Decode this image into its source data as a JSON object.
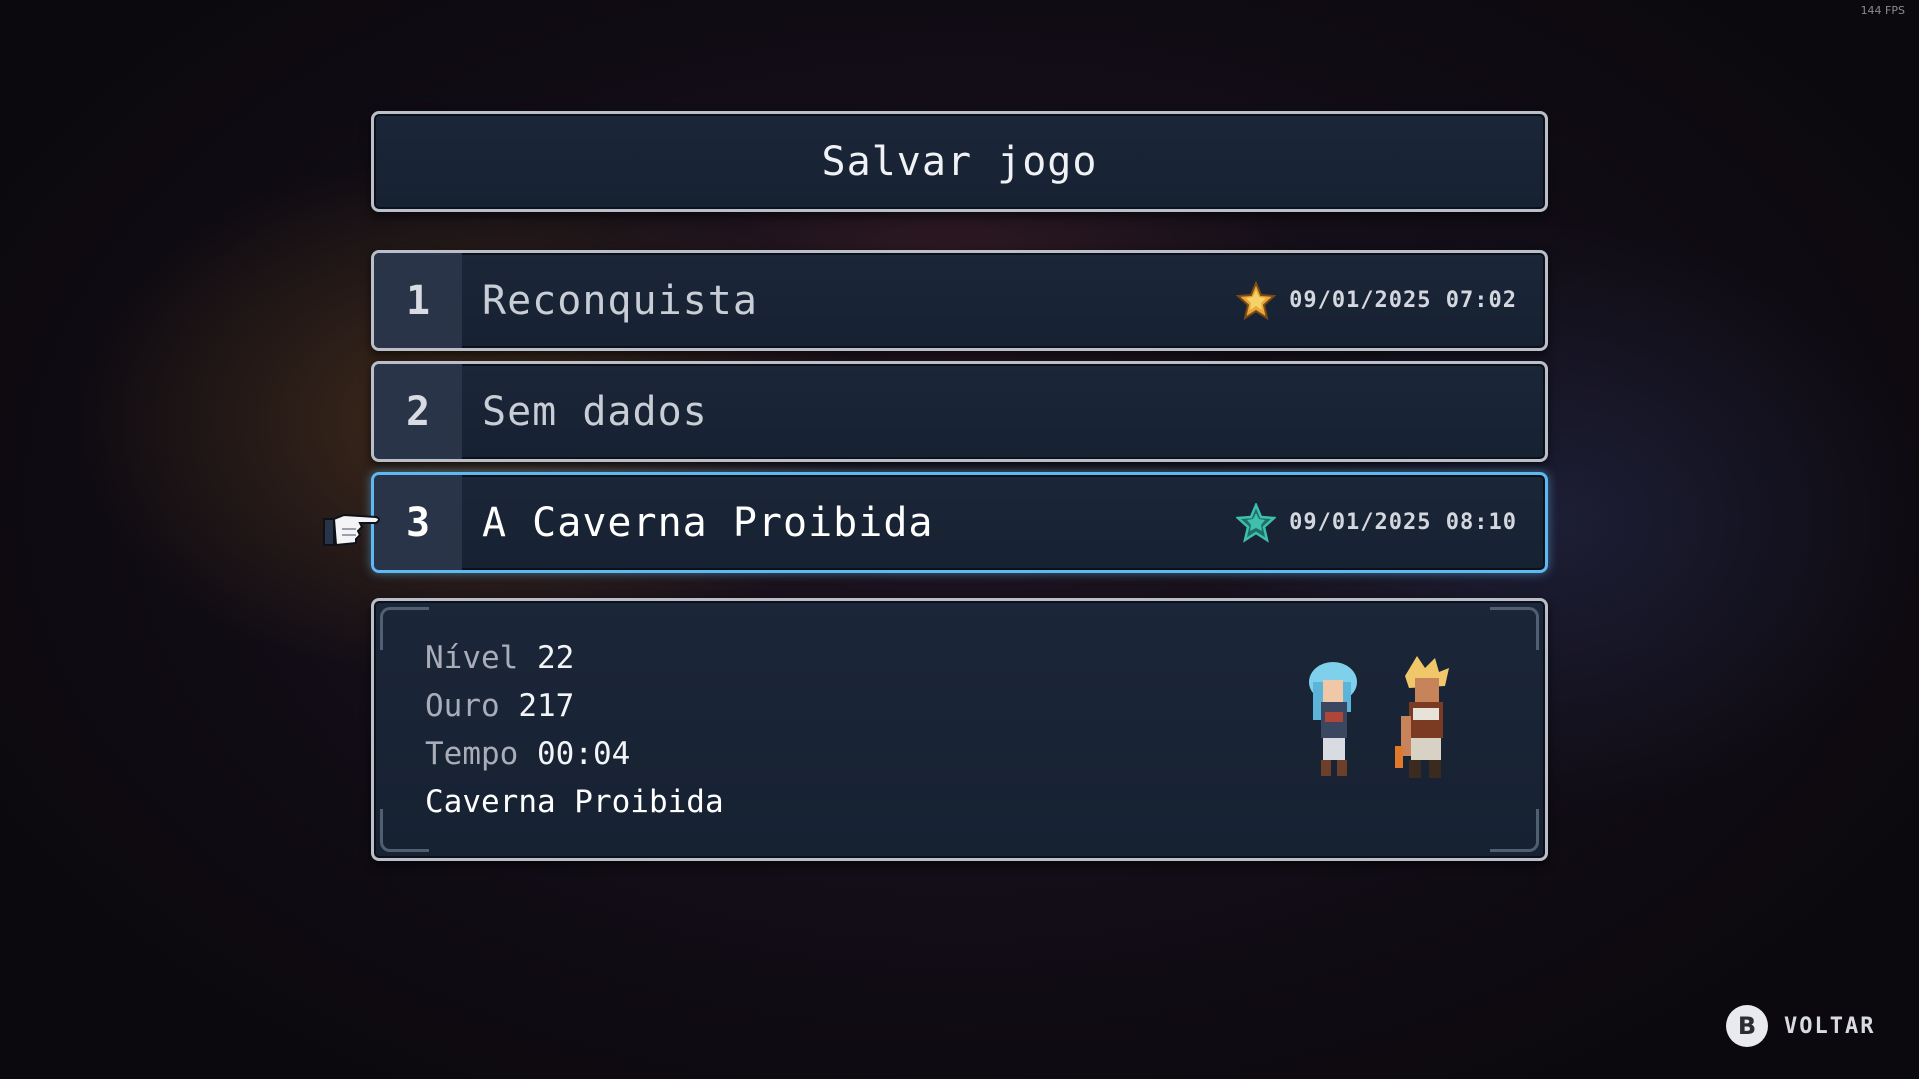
{
  "hud": {
    "fps": "144 FPS"
  },
  "title": "Salvar jogo",
  "slots": [
    {
      "number": "1",
      "name": "Reconquista",
      "date": "09/01/2025 07:02",
      "star_color": "#e8a93a"
    },
    {
      "number": "2",
      "name": "Sem dados"
    },
    {
      "number": "3",
      "name": "A Caverna Proibida",
      "date": "09/01/2025 08:10",
      "star_color": "#3fbfae",
      "selected": true
    }
  ],
  "details": {
    "level_label": "Nível",
    "level": "22",
    "gold_label": "Ouro",
    "gold": "217",
    "time_label": "Tempo",
    "time": "00:04",
    "location": "Caverna Proibida"
  },
  "controls": {
    "back_button": "B",
    "back_label": "VOLTAR"
  },
  "icons": {
    "cursor": "pointing-hand-icon",
    "slot1_star": "gold-star-icon",
    "slot3_star": "teal-star-icon"
  },
  "colors": {
    "selection_border": "#5fb8f0",
    "panel_bg": "#1b2638",
    "panel_border": "#b9bec8"
  }
}
